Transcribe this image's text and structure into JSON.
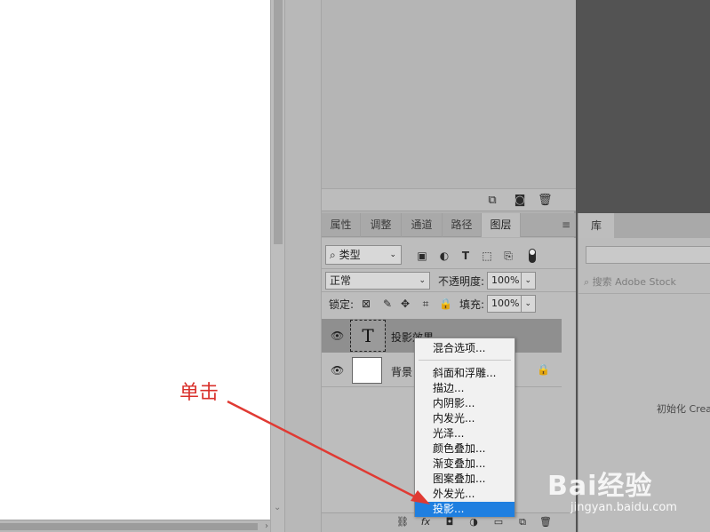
{
  "layers_panel": {
    "tabs": [
      "属性",
      "调整",
      "通道",
      "路径",
      "图层"
    ],
    "active_tab": "图层",
    "filter_label": "类型",
    "blend_mode": "正常",
    "opacity_label": "不透明度:",
    "opacity_value": "100%",
    "lock_label": "锁定:",
    "fill_label": "填充:",
    "fill_value": "100%",
    "layers": [
      {
        "name": "投影效果",
        "type": "text",
        "thumb": "T"
      },
      {
        "name": "背景",
        "type": "background"
      }
    ]
  },
  "context_menu": {
    "items": [
      "混合选项...",
      "斜面和浮雕...",
      "描边...",
      "内阴影...",
      "内发光...",
      "光泽...",
      "颜色叠加...",
      "渐变叠加...",
      "图案叠加...",
      "外发光...",
      "投影..."
    ],
    "highlighted": "投影..."
  },
  "library_panel": {
    "tab": "库",
    "search_placeholder": "搜索 Adobe Stock",
    "status_text": "初始化 Crea"
  },
  "annotation": {
    "text": "单击",
    "color": "#d9302b"
  },
  "watermark": {
    "brand": "Bai经验",
    "url": "jingyan.baidu.com"
  },
  "colors": {
    "menu_highlight": "#1f7fe0",
    "panel_bg": "#bdbdbd"
  }
}
